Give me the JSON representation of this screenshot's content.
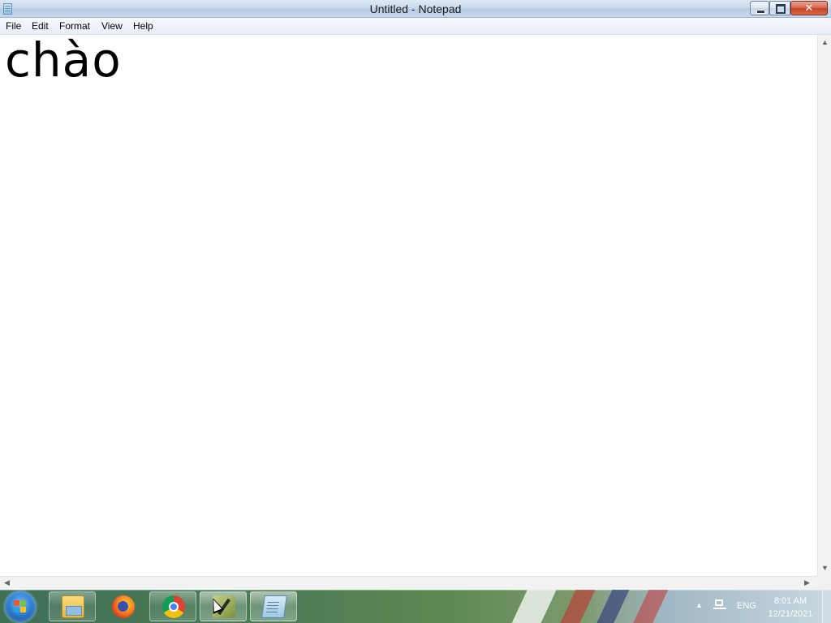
{
  "window": {
    "title": "Untitled - Notepad",
    "close_symbol": "✕"
  },
  "menu": {
    "items": [
      "File",
      "Edit",
      "Format",
      "View",
      "Help"
    ]
  },
  "editor": {
    "content": "chào"
  },
  "scrollbars": {
    "up": "▲",
    "down": "▼",
    "left": "◀",
    "right": "▶"
  },
  "taskbar": {
    "pinned": [
      {
        "name": "windows-explorer",
        "icon": "folder-icon"
      },
      {
        "name": "firefox",
        "icon": "firefox-icon"
      },
      {
        "name": "chrome",
        "icon": "chrome-icon"
      },
      {
        "name": "tool-app",
        "icon": "tool-icon"
      },
      {
        "name": "notepad",
        "icon": "notepad-icon"
      }
    ],
    "tray": {
      "expand_symbol": "▲",
      "language": "ENG",
      "time": "8:01 AM",
      "date": "12/21/2021"
    }
  }
}
